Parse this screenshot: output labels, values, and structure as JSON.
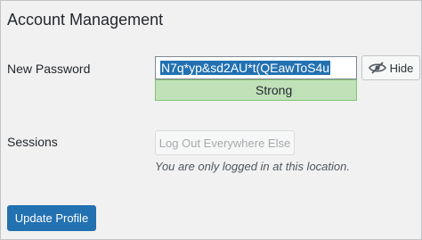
{
  "section": {
    "title": "Account Management"
  },
  "password": {
    "label": "New Password",
    "value": "N7q*yp&sd2AU*t(QEawToS4u",
    "strength_text": "Strong",
    "hide_label": "Hide",
    "hide_icon": "eye-slash-icon"
  },
  "sessions": {
    "label": "Sessions",
    "logout_label": "Log Out Everywhere Else",
    "note": "You are only logged in at this location."
  },
  "actions": {
    "update_label": "Update Profile"
  },
  "colors": {
    "accent": "#2271b1",
    "strong_bg": "#c1e1b9",
    "strong_border": "#83c373",
    "background": "#f1f1f1"
  }
}
